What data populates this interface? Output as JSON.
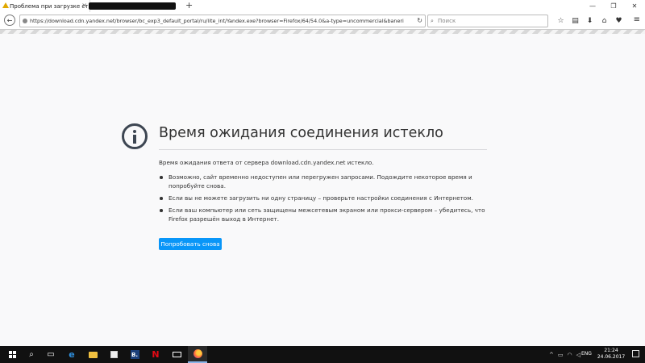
{
  "browser": {
    "tab_title": "Проблема при загрузке ст",
    "new_tab": "+",
    "url": "https://download.cdn.yandex.net/browser/bc_exp3_default_portal/ru/lite_int/Yandex.exe?browser=Firefox/64/54.0&a-type=uncommercial&baneri",
    "search_placeholder": "Поиск",
    "icons": [
      "warning-icon",
      "close-icon",
      "back-icon",
      "info-icon",
      "reload-icon",
      "search-icon",
      "bookmark-star-icon",
      "library-icon",
      "download-icon",
      "home-icon",
      "pocket-icon",
      "menu-icon"
    ]
  },
  "error": {
    "title": "Время ожидания соединения истекло",
    "description": "Время ожидания ответа от сервера download.cdn.yandex.net истекло.",
    "bullets": [
      "Возможно, сайт временно недоступен или перегружен запросами. Подождите некоторое время и попробуйте снова.",
      "Если вы не можете загрузить ни одну страницу – проверьте настройки соединения с Интернетом.",
      "Если ваш компьютер или сеть защищены межсетевым экраном или прокси-сервером – убедитесь, что Firefox разрешён выход в Интернет."
    ],
    "retry_label": "Попробовать снова"
  },
  "taskbar": {
    "language": "ENG",
    "time": "21:24",
    "date": "24.06.2017",
    "booking_letter": "B.",
    "netflix_letter": "N",
    "ie_letter": "e",
    "accent": "#0996f8"
  }
}
